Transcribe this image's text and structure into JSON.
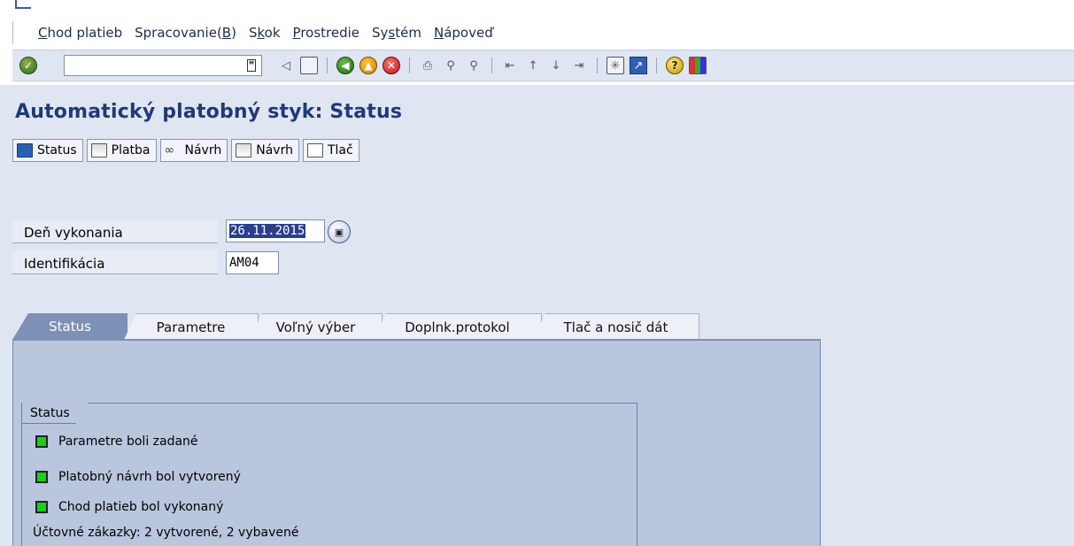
{
  "menubar": {
    "items": [
      {
        "pre": "",
        "u": "C",
        "post": "hod platieb"
      },
      {
        "pre": "Spracovanie(",
        "u": "B",
        "post": ")"
      },
      {
        "pre": "S",
        "u": "k",
        "post": "ok"
      },
      {
        "pre": "",
        "u": "P",
        "post": "rostredie"
      },
      {
        "pre": "Sy",
        "u": "s",
        "post": "tém"
      },
      {
        "pre": "",
        "u": "N",
        "post": "ápoveď"
      }
    ]
  },
  "toolbar": {
    "command_value": "",
    "icons": [
      "check-icon",
      "dropdown-icon",
      "back-arrow-icon",
      "save-icon",
      "back-icon",
      "exit-icon",
      "cancel-icon",
      "print-icon",
      "find-icon",
      "find-next-icon",
      "first-page-icon",
      "previous-page-icon",
      "next-page-icon",
      "last-page-icon",
      "create-session-icon",
      "shortcut-icon",
      "help-icon",
      "layout-menu-icon"
    ]
  },
  "page": {
    "title": "Automatický platobný styk: Status"
  },
  "app_toolbar": {
    "buttons": [
      "Status",
      "Platba",
      "Návrh",
      "Návrh",
      "Tlač"
    ]
  },
  "form": {
    "run_date_label": "Deň vykonania",
    "run_date_value": "26.11.2015",
    "identification_label": "Identifikácia",
    "identification_value": "AM04"
  },
  "tabs": [
    "Status",
    "Parametre",
    "Voľný výber",
    "Doplnk.protokol",
    "Tlač a nosič dát"
  ],
  "status_group": {
    "title": "Status",
    "lines": [
      "Parametre boli zadané",
      "Platobný návrh bol vytvorený",
      "Chod platieb bol vykonaný"
    ],
    "summary": "Účtovné zákazky: 2 vytvorené, 2 vybavené"
  }
}
